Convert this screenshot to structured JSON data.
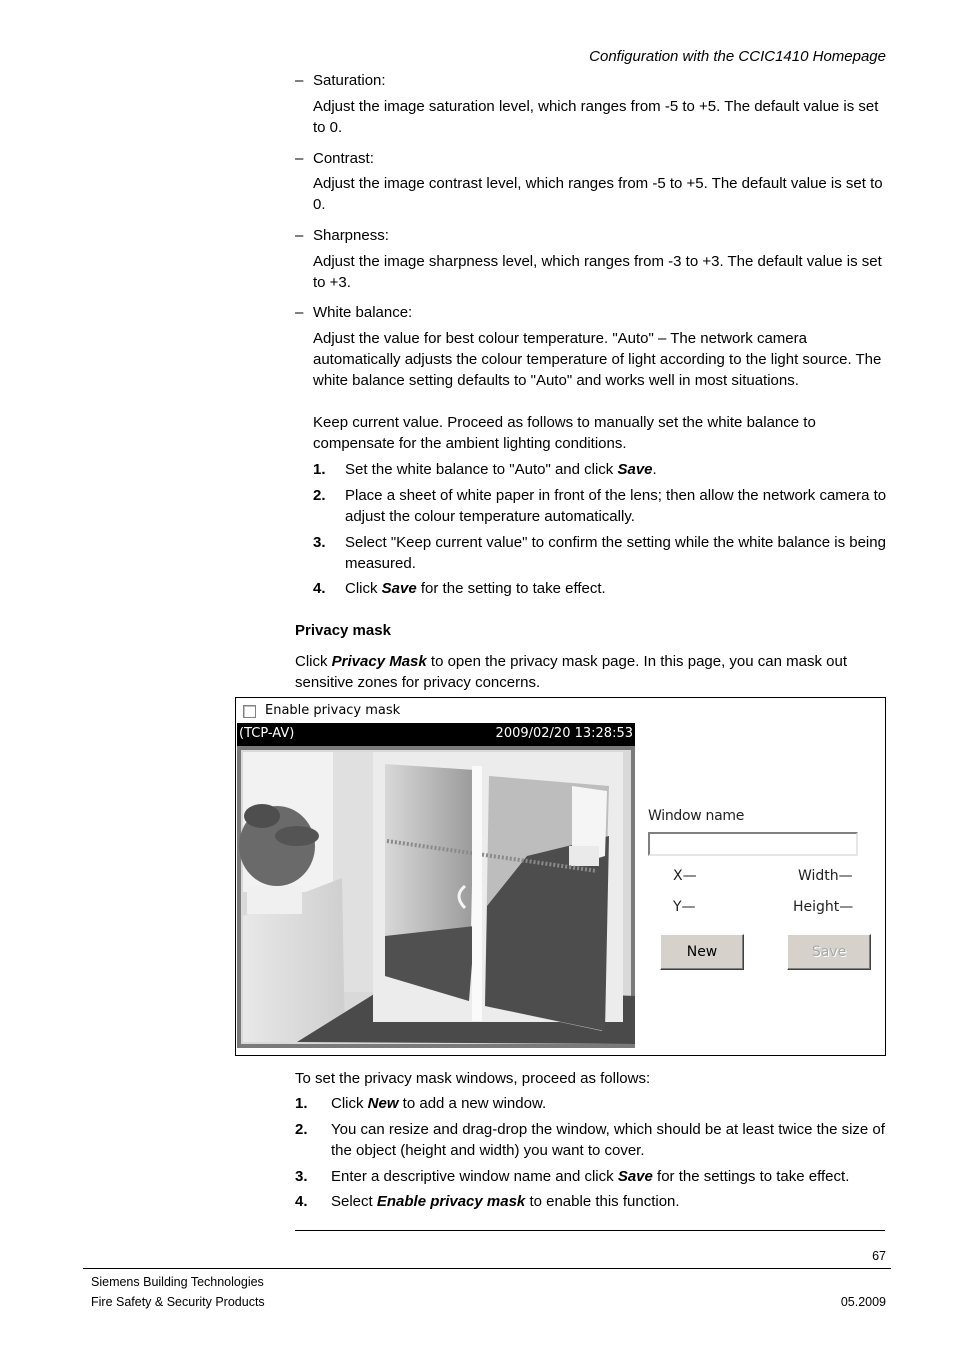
{
  "page_header": "Configuration with the CCIC1410 Homepage",
  "settings": [
    {
      "label": "Saturation:",
      "description": "Adjust the image saturation level, which ranges from -5 to +5. The default value is set to 0."
    },
    {
      "label": "Contrast:",
      "description": "Adjust the image contrast level, which ranges from -5 to +5. The default value is set to 0."
    },
    {
      "label": "Sharpness:",
      "description": "Adjust the image sharpness level, which ranges from -3 to +3. The default value is set to +3."
    },
    {
      "label": "White balance:",
      "description": "Adjust the value for best colour temperature. \"Auto\" – The network camera automatically adjusts the colour temperature of light according to the light source. The white balance setting defaults to \"Auto\" and works well in most situations.",
      "description2": "Keep current value. Proceed as follows to manually set the white balance to compensate for the ambient lighting conditions."
    }
  ],
  "white_balance_steps": [
    {
      "num": "1.",
      "pre": "Set the white balance to \"Auto\" and click ",
      "em": "Save",
      "post": "."
    },
    {
      "num": "2.",
      "pre": "Place a sheet of white paper in front of the lens; then allow the network camera to adjust the colour temperature automatically.",
      "em": "",
      "post": ""
    },
    {
      "num": "3.",
      "pre": "Select \"Keep current value\" to confirm the setting while the white balance is being measured.",
      "em": "",
      "post": ""
    },
    {
      "num": "4.",
      "pre": "Click ",
      "em": "Save",
      "post": " for the setting to take effect."
    }
  ],
  "privacy": {
    "heading": "Privacy mask",
    "intro_pre": "Click ",
    "intro_em": "Privacy Mask",
    "intro_post": " to open the privacy mask page. In this page, you can mask out sensitive zones for privacy concerns.",
    "ui": {
      "enable_label": "Enable privacy mask",
      "enable_checked": false,
      "stream_label": "(TCP-AV)",
      "timestamp": "2009/02/20 13:28:53",
      "window_name_label": "Window name",
      "window_name_value": "",
      "x_label": "X—",
      "y_label": "Y—",
      "width_label": "Width—",
      "height_label": "Height—",
      "new_button": "New",
      "save_button": "Save"
    },
    "steps_intro": "To set the privacy mask windows, proceed as follows:",
    "steps": [
      {
        "num": "1.",
        "pre": "Click ",
        "em": "New",
        "post": " to add a new window."
      },
      {
        "num": "2.",
        "pre": "You can resize and drag-drop the window, which should be at least twice the size of the object (height and width) you want to cover.",
        "em": "",
        "post": ""
      },
      {
        "num": "3.",
        "pre": "Enter a descriptive window name and click ",
        "em": "Save",
        "post": " for the settings to take effect."
      },
      {
        "num": "4.",
        "pre": "Select ",
        "em": "Enable privacy mask",
        "post": " to enable this function."
      }
    ]
  },
  "footer": {
    "page_number": "67",
    "company": "Siemens Building Technologies",
    "division": "Fire Safety & Security Products",
    "date": "05.2009"
  }
}
